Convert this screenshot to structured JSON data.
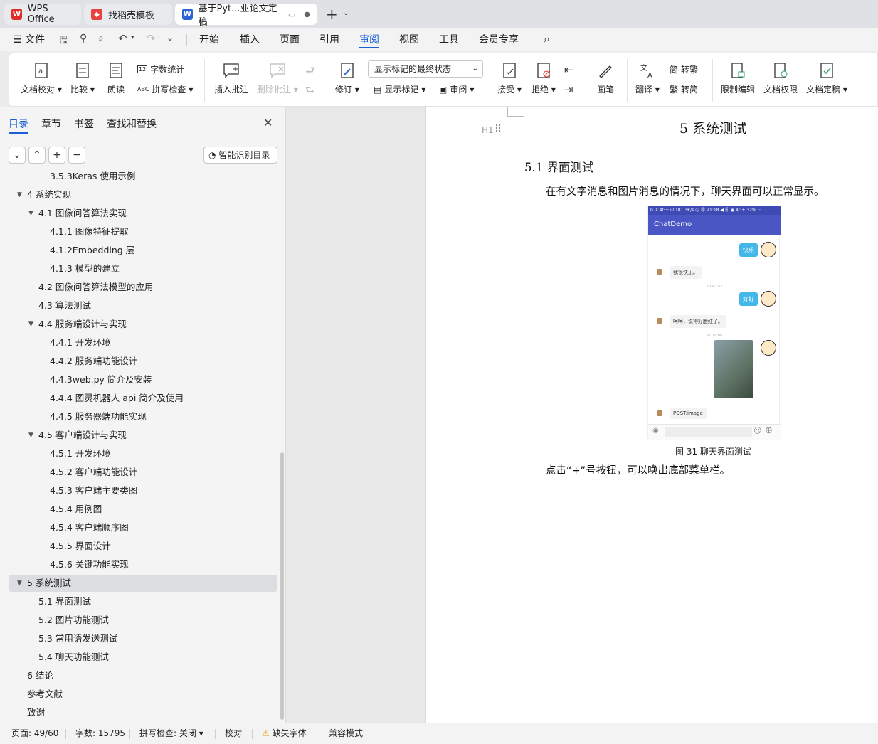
{
  "tabs": [
    {
      "label": "WPS Office"
    },
    {
      "label": "找稻壳模板"
    },
    {
      "label": "基于Pyt...业论文定稿"
    }
  ],
  "menu": {
    "file": "文件",
    "items": [
      "开始",
      "插入",
      "页面",
      "引用",
      "审阅",
      "视图",
      "工具",
      "会员专享"
    ],
    "active": "审阅"
  },
  "ribbon": {
    "doc_proof": "文档校对",
    "compare": "比较",
    "read_aloud": "朗读",
    "word_count": "字数统计",
    "spell_check": "拼写检查",
    "insert_comment": "插入批注",
    "delete_comment": "删除批注",
    "revise": "修订",
    "markup_state": "显示标记的最终状态",
    "show_markup": "显示标记",
    "review": "审阅",
    "accept": "接受",
    "reject": "拒绝",
    "pen": "画笔",
    "translate": "翻译",
    "to_traditional": "转繁",
    "to_simplified": "转简",
    "restrict_edit": "限制编辑",
    "doc_permission": "文档权限",
    "finalize": "文档定稿"
  },
  "panel": {
    "tabs": [
      "目录",
      "章节",
      "书签",
      "查找和替换"
    ],
    "smart_toc": "智能识别目录",
    "toc": [
      {
        "text": "3.5.3Keras 使用示例",
        "level": 3
      },
      {
        "text": "4 系统实现",
        "level": 1,
        "expand": true
      },
      {
        "text": "4.1 图像问答算法实现",
        "level": 2,
        "expand": true
      },
      {
        "text": "4.1.1 图像特征提取",
        "level": 3
      },
      {
        "text": "4.1.2Embedding 层",
        "level": 3
      },
      {
        "text": "4.1.3 模型的建立",
        "level": 3
      },
      {
        "text": "4.2 图像问答算法模型的应用",
        "level": 2
      },
      {
        "text": "4.3 算法测试",
        "level": 2
      },
      {
        "text": "4.4 服务端设计与实现",
        "level": 2,
        "expand": true
      },
      {
        "text": "4.4.1 开发环境",
        "level": 3
      },
      {
        "text": "4.4.2 服务端功能设计",
        "level": 3
      },
      {
        "text": "4.4.3web.py 简介及安装",
        "level": 3
      },
      {
        "text": "4.4.4 图灵机器人 api 简介及使用",
        "level": 3
      },
      {
        "text": "4.4.5 服务器端功能实现",
        "level": 3
      },
      {
        "text": "4.5 客户端设计与实现",
        "level": 2,
        "expand": true
      },
      {
        "text": "4.5.1 开发环境",
        "level": 3
      },
      {
        "text": "4.5.2 客户端功能设计",
        "level": 3
      },
      {
        "text": "4.5.3 客户端主要类图",
        "level": 3
      },
      {
        "text": "4.5.4 用例图",
        "level": 3
      },
      {
        "text": "4.5.4 客户端顺序图",
        "level": 3
      },
      {
        "text": "4.5.5 界面设计",
        "level": 3
      },
      {
        "text": "4.5.6 关键功能实现",
        "level": 3
      },
      {
        "text": "5 系统测试",
        "level": 1,
        "expand": true,
        "selected": true
      },
      {
        "text": "5.1 界面测试",
        "level": 2
      },
      {
        "text": "5.2 图片功能测试",
        "level": 2
      },
      {
        "text": "5.3 常用语发送测试",
        "level": 2
      },
      {
        "text": "5.4 聊天功能测试",
        "level": 2
      },
      {
        "text": "6 结论",
        "level": 1
      },
      {
        "text": "参考文献",
        "level": 1
      },
      {
        "text": "致谢",
        "level": 1
      }
    ]
  },
  "document": {
    "heading_marker": "H1",
    "chapter_title": "5 系统测试",
    "section_title": "5.1 界面测试",
    "para1": "在有文字消息和图片消息的情况下，聊天界面可以正常显示。",
    "figure_caption": "图  31 聊天界面测试",
    "para2": "点击“+”号按钮，可以唤出底部菜单栏。",
    "phone": {
      "status_text": "0.ıll 4G+.ıll 181.3K/s ☺ ⓔ   21:18          ◀ ⓝ ◉ 4G+ 32% ▭",
      "app_title": "ChatDemo",
      "msg1": "快乐",
      "reply1": "我很快乐。",
      "time1": "20:47:52",
      "msg2": "好好",
      "reply2": "呵呵，说得好脸红了。",
      "time2": "21:18:06",
      "reply3": "POST:image"
    }
  },
  "status": {
    "page": "页面: 49/60",
    "words": "字数: 15795",
    "spell": "拼写检查: 关闭",
    "proof": "校对",
    "missing_font": "缺失字体",
    "compat": "兼容模式"
  }
}
